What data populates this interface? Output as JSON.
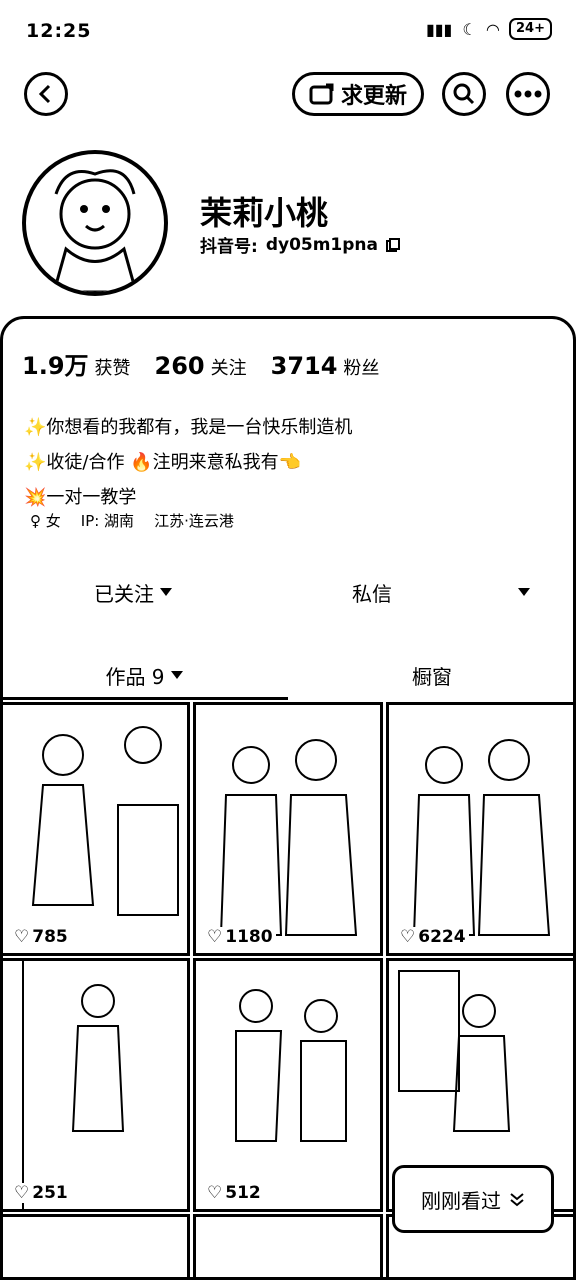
{
  "status": {
    "time": "12:25",
    "battery": "24+"
  },
  "header": {
    "update_label": "求更新"
  },
  "profile": {
    "name": "茉莉小桃",
    "id_label": "抖音号:",
    "id_value": "dy05m1pna"
  },
  "stats": [
    {
      "value": "1.9万",
      "label": "获赞"
    },
    {
      "value": "260",
      "label": "关注"
    },
    {
      "value": "3714",
      "label": "粉丝"
    }
  ],
  "bio": {
    "line1": "✨你想看的我都有，我是一台快乐制造机",
    "line2": "✨收徒/合作 🔥注明来意私我有👈",
    "line3": "💥一对一教学"
  },
  "tags": {
    "gender": "♀ 女",
    "ip": "IP: 湖南",
    "location": "江苏·连云港"
  },
  "actions": {
    "follow_label": "已关注",
    "message_label": "私信"
  },
  "tabs": {
    "works_label": "作品 9",
    "showcase_label": "橱窗"
  },
  "videos": [
    {
      "likes": "785"
    },
    {
      "likes": "1180"
    },
    {
      "likes": "6224"
    },
    {
      "likes": "251"
    },
    {
      "likes": "512"
    },
    {
      "likes": ""
    }
  ],
  "floating": {
    "seen_label": "刚刚看过"
  },
  "icons": [
    "back-icon",
    "update-icon",
    "search-icon",
    "more-icon",
    "copy-icon",
    "heart-icon",
    "chevron-down-icon"
  ]
}
